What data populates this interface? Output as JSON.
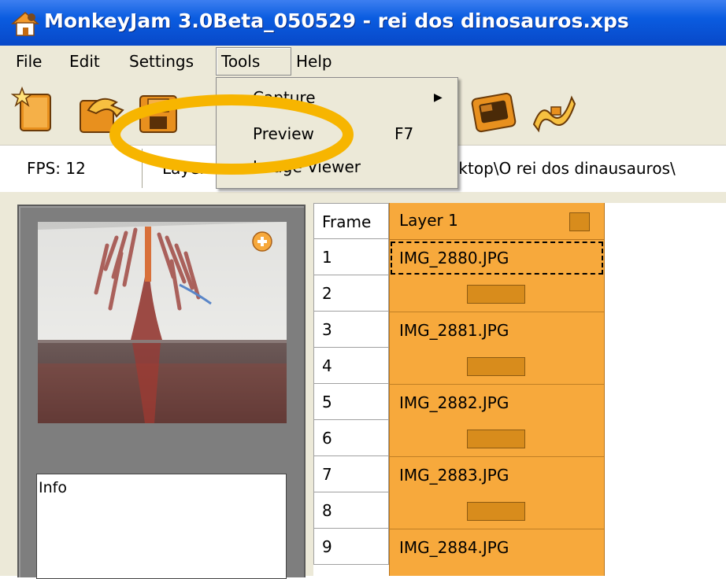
{
  "window": {
    "title": "MonkeyJam 3.0Beta_050529 - rei dos dinosauros.xps",
    "app_icon": "house-icon"
  },
  "menubar": {
    "items": [
      {
        "label": "File"
      },
      {
        "label": "Edit"
      },
      {
        "label": "Settings"
      },
      {
        "label": "Tools",
        "open": true
      },
      {
        "label": "Help"
      }
    ]
  },
  "tools_menu": {
    "items": [
      {
        "label": "Capture",
        "submenu": true
      },
      {
        "label": "Preview",
        "shortcut": "F7",
        "highlighted_by_annotation": true
      },
      {
        "label": "Image Viewer"
      }
    ]
  },
  "toolbar": {
    "icons": [
      "new-file-icon",
      "open-file-icon",
      "save-file-icon",
      "camera-icon",
      "film-icon"
    ]
  },
  "statusbar": {
    "fps": "FPS: 12",
    "layer": "Layer",
    "path": "sktop\\O rei dos dinausauros\\"
  },
  "preview": {
    "info_label": "Info",
    "zoom_icon": "plus-circle-icon"
  },
  "grid": {
    "frame_header": "Frame",
    "layer_header": "Layer 1",
    "frames": [
      "1",
      "2",
      "3",
      "4",
      "5",
      "6",
      "7",
      "8",
      "9"
    ],
    "cells": [
      {
        "text": "IMG_2880.JPG",
        "selected": true
      },
      {
        "hold": true
      },
      {
        "text": "IMG_2881.JPG"
      },
      {
        "hold": true
      },
      {
        "text": "IMG_2882.JPG"
      },
      {
        "hold": true
      },
      {
        "text": "IMG_2883.JPG"
      },
      {
        "hold": true
      },
      {
        "text": "IMG_2884.JPG"
      }
    ]
  },
  "colors": {
    "titlebar": "#0a5ce0",
    "layer_fill": "#f7a93c",
    "hold_bar": "#d88c1c",
    "annotation": "#f7b500",
    "chrome": "#ece9d8"
  }
}
